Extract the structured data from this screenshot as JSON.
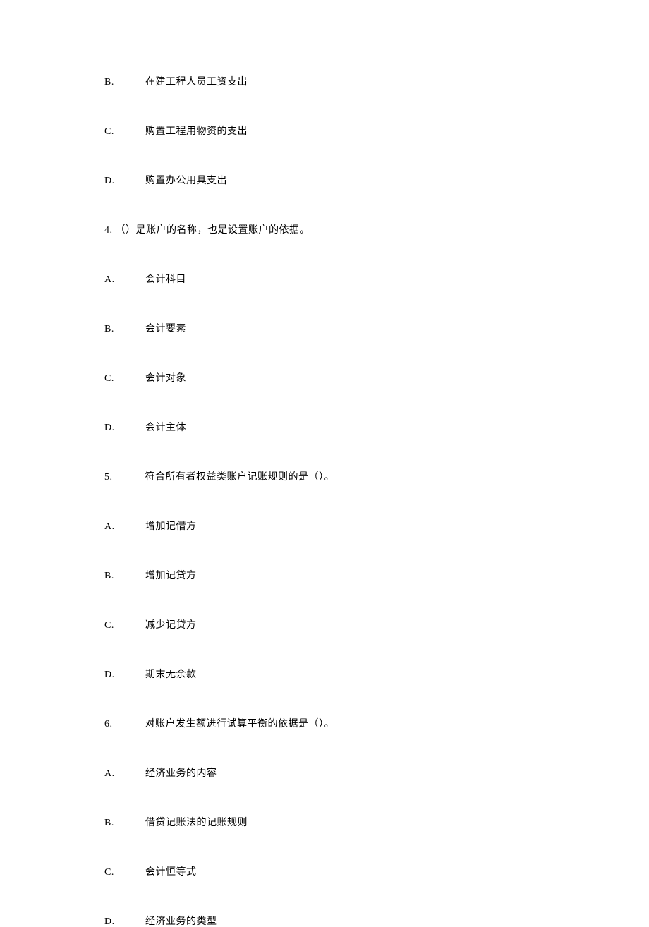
{
  "options_top": [
    {
      "label": "B.",
      "text": "在建工程人员工资支出"
    },
    {
      "label": "C.",
      "text": "购置工程用物资的支出"
    },
    {
      "label": "D.",
      "text": "购置办公用具支出"
    }
  ],
  "q4": {
    "number": "4.",
    "text": "（）是账户的名称，也是设置账户的依据。",
    "options": [
      {
        "label": "A.",
        "text": "会计科目"
      },
      {
        "label": "B.",
        "text": "会计要素"
      },
      {
        "label": "C.",
        "text": "会计对象"
      },
      {
        "label": "D.",
        "text": "会计主体"
      }
    ]
  },
  "q5": {
    "number": "5.",
    "text": "符合所有者权益类账户记账规则的是（）。",
    "options": [
      {
        "label": "A.",
        "text": "增加记借方"
      },
      {
        "label": "B.",
        "text": "增加记贷方"
      },
      {
        "label": "C.",
        "text": "减少记贷方"
      },
      {
        "label": "D.",
        "text": "期末无余款"
      }
    ]
  },
  "q6": {
    "number": "6.",
    "text": "对账户发生额进行试算平衡的依据是（）。",
    "options": [
      {
        "label": "A.",
        "text": "经济业务的内容"
      },
      {
        "label": "B.",
        "text": "借贷记账法的记账规则"
      },
      {
        "label": "C.",
        "text": "会计恒等式"
      },
      {
        "label": "D.",
        "text": "经济业务的类型"
      }
    ]
  }
}
